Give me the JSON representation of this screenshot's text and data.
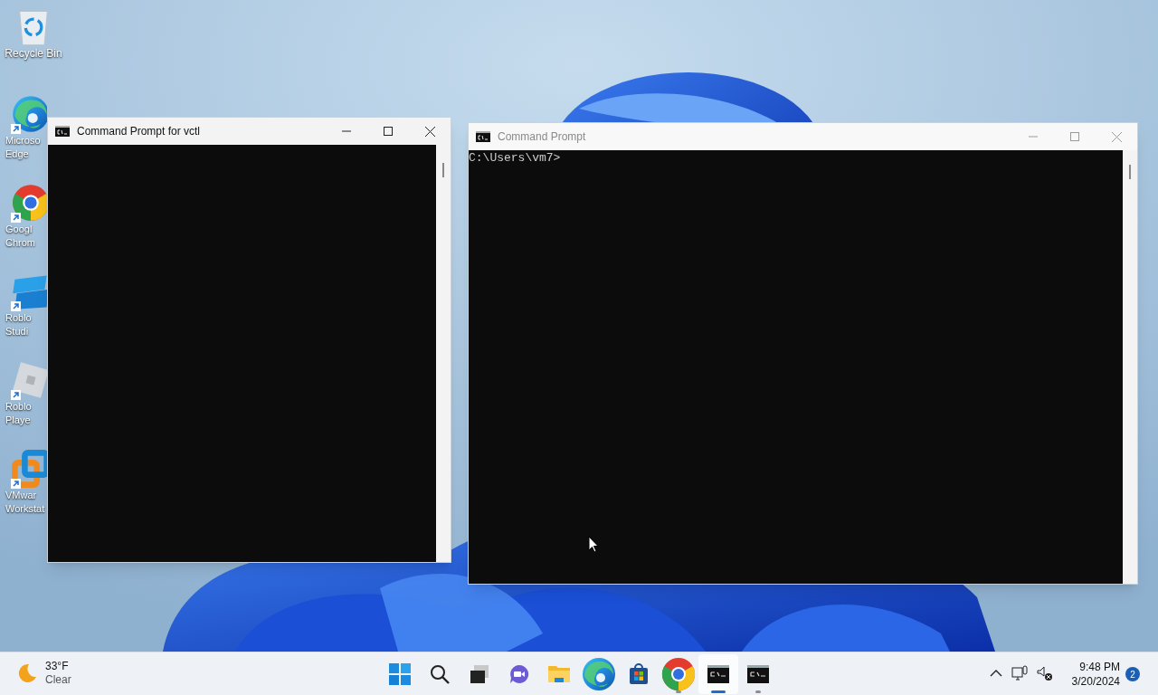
{
  "desktop_icons": [
    {
      "kind": "recycle-bin",
      "shortcut": false,
      "lines": [
        "Recycle Bin"
      ]
    },
    {
      "kind": "edge",
      "shortcut": true,
      "lines": [
        "Microso",
        "Edge"
      ]
    },
    {
      "kind": "chrome",
      "shortcut": true,
      "lines": [
        "Googl",
        "Chrom"
      ]
    },
    {
      "kind": "studio",
      "shortcut": true,
      "lines": [
        "Roblo",
        "Studi"
      ]
    },
    {
      "kind": "player",
      "shortcut": true,
      "lines": [
        "Roblo",
        "Playe"
      ]
    },
    {
      "kind": "vmware",
      "shortcut": true,
      "lines": [
        "VMwar",
        "Workstat"
      ]
    }
  ],
  "windows": [
    {
      "title": "Command Prompt for vctl",
      "active": true
    },
    {
      "title": "Command Prompt",
      "active": false,
      "lines": [
        "C:\\Users\\vm7>"
      ]
    }
  ],
  "taskbar": {
    "weather": {
      "temperature": "33°F",
      "condition": "Clear"
    },
    "apps": [
      {
        "kind": "start",
        "running": false,
        "selected": false
      },
      {
        "kind": "search",
        "running": false,
        "selected": false
      },
      {
        "kind": "task-view",
        "running": false,
        "selected": false
      },
      {
        "kind": "chat",
        "running": false,
        "selected": false
      },
      {
        "kind": "folder",
        "running": false,
        "selected": false
      },
      {
        "kind": "edge",
        "running": false,
        "selected": false
      },
      {
        "kind": "store",
        "running": false,
        "selected": false
      },
      {
        "kind": "chrome",
        "running": true,
        "selected": false
      },
      {
        "kind": "terminal",
        "running": true,
        "selected": true
      },
      {
        "kind": "terminal",
        "running": true,
        "selected": false
      }
    ],
    "time": "9:48 PM",
    "date": "3/20/2024",
    "notifications": "2"
  }
}
